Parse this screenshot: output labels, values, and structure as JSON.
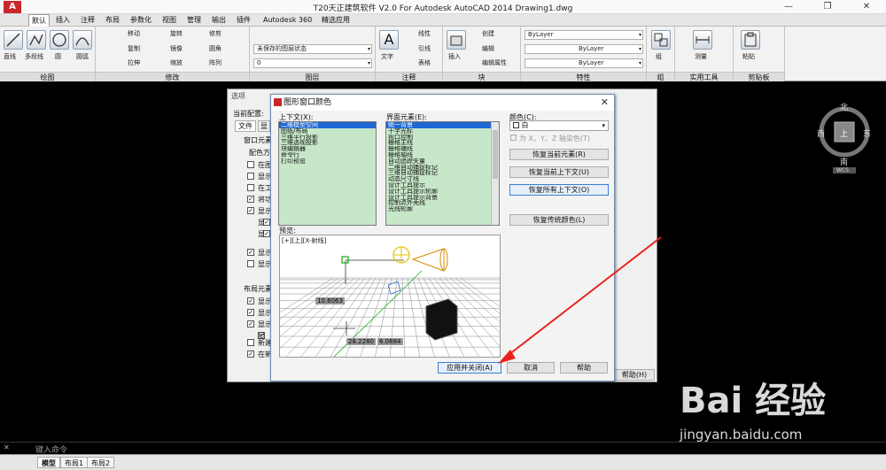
{
  "titlebar": {
    "title": "T20天正建筑软件 V2.0 For Autodesk AutoCAD 2014   Drawing1.dwg",
    "min": "—",
    "max": "❐",
    "close": "✕"
  },
  "menubar": {
    "items": [
      "默认",
      "插入",
      "注释",
      "布局",
      "参数化",
      "视图",
      "管理",
      "输出",
      "插件",
      "Autodesk 360",
      "精选应用"
    ]
  },
  "ribbon": {
    "draw_panel": {
      "title": "绘图",
      "tools": [
        "直线",
        "多段线",
        "圆",
        "圆弧"
      ]
    },
    "modify_panel": {
      "title": "修改",
      "tools": [
        "移动",
        "旋转",
        "修剪",
        "复制",
        "镜像",
        "圆角",
        "拉伸",
        "缩放",
        "阵列"
      ]
    },
    "layer_panel": {
      "title": "图层",
      "unsaved": "未保存的图层状态",
      "layer0": "0"
    },
    "annot_panel": {
      "title": "注释",
      "tools": [
        "文字",
        "线性",
        "引线",
        "表格"
      ]
    },
    "block_panel": {
      "title": "块",
      "tools": [
        "插入",
        "创建",
        "编辑",
        "编辑属性"
      ]
    },
    "prop_panel": {
      "title": "特性",
      "bylayer1": "ByLayer",
      "bylayer2": "ByLayer",
      "bylayer3": "ByLayer"
    },
    "group_panel": {
      "title": "组",
      "tool": "组"
    },
    "util_panel": {
      "title": "实用工具",
      "tool": "测量"
    },
    "clip_panel": {
      "title": "剪贴板",
      "tool": "粘贴"
    }
  },
  "options_dialog": {
    "title": "选项",
    "current_config": "当前配置:",
    "tabs": [
      "文件",
      "显"
    ],
    "window_elements": "窗口元素",
    "color_scheme": "配色方",
    "checks": [
      "在图",
      "显示",
      "在工",
      "将功",
      "显示",
      "显",
      "显",
      "显示",
      "显示"
    ],
    "layout_elements": "布局元素",
    "layout_checks": [
      "显示",
      "显示",
      "显示",
      "显",
      "新建",
      "在新"
    ],
    "help_btn": "帮助(H)"
  },
  "color_dialog": {
    "title": "图形窗口颜色",
    "close": "✕",
    "context_label": "上下文(X):",
    "context_items": [
      "二维模型空间",
      "图纸/布局",
      "三维平行投影",
      "三维透视投影",
      "块编辑器",
      "命令行",
      "打印预览"
    ],
    "context_selected": 0,
    "element_label": "界面元素(E):",
    "element_items": [
      "统一背景",
      "十字光标",
      "视口控制",
      "栅格主线",
      "栅格辅线",
      "栅格轴线",
      "自动追踪矢量",
      "二维自动捕捉标记",
      "三维自动捕捉标记",
      "动态尺寸线",
      "设计工具提示",
      "设计工具提示轮廓",
      "设计工具提示背景",
      "控制点外壳线",
      "光线轮廓"
    ],
    "element_selected": 0,
    "color_label": "颜色(C):",
    "color_value": "白",
    "tint_label": "为 X、Y、Z 轴染色(T)",
    "btn_restore_elem": "恢复当前元素(R)",
    "btn_restore_ctx": "恢复当前上下文(U)",
    "btn_restore_all": "恢复所有上下文(O)",
    "btn_restore_classic": "恢复传统颜色(L)",
    "preview_label": "预览:",
    "preview_view": "[+][上][X-射线]",
    "preview_dim1": "10.6063",
    "preview_dim2": "28.2280",
    "preview_dim3": "6.0884",
    "btn_apply": "应用并关闭(A)",
    "btn_cancel": "取消",
    "btn_help": "帮助"
  },
  "viewcube": {
    "north": "北",
    "south": "南",
    "east": "东",
    "west": "西",
    "top": "上",
    "wcs": "WCS"
  },
  "statusbar": {
    "tabs": [
      "模型",
      "布局1",
      "布局2"
    ],
    "cmd_hint": "键入命令"
  },
  "watermark": {
    "logo": "Bai 经验",
    "url": "jingyan.baidu.com"
  },
  "colors": {
    "accent": "#1f67d2",
    "list_bg": "#c7e7c9",
    "arrow": "#e8231f"
  }
}
